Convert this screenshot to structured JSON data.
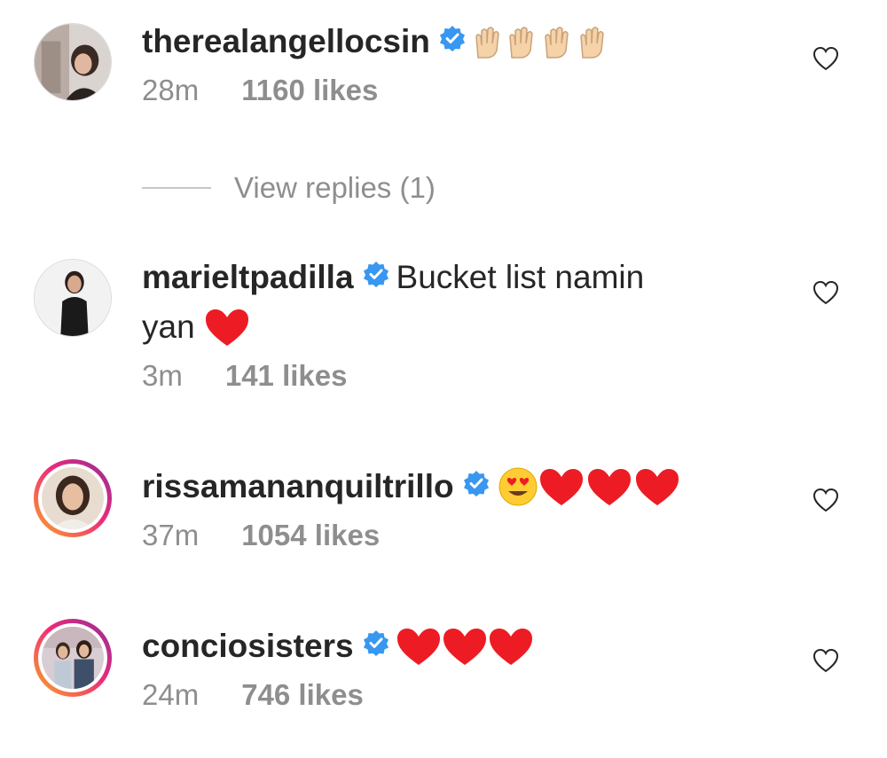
{
  "comments": [
    {
      "username": "therealangellocsin",
      "text": "",
      "emoji": "🙌🙌🙌🙌",
      "time": "28m",
      "likes": "1160 likes"
    },
    {
      "username": "marieltpadilla",
      "text": "Bucket list namin",
      "text2": "yan",
      "emoji": "❤️",
      "time": "3m",
      "likes": "141 likes"
    },
    {
      "username": "rissamananquiltrillo",
      "text": "",
      "emoji": "😍❤️❤️❤️",
      "time": "37m",
      "likes": "1054 likes"
    },
    {
      "username": "conciosisters",
      "text": "",
      "emoji": "❤️❤️❤️",
      "time": "24m",
      "likes": "746 likes"
    }
  ],
  "replies_link": "View replies (1)",
  "colors": {
    "text": "#262626",
    "secondary": "#8e8e8e",
    "verified": "#3897f0",
    "heart": "#ed1c24"
  }
}
